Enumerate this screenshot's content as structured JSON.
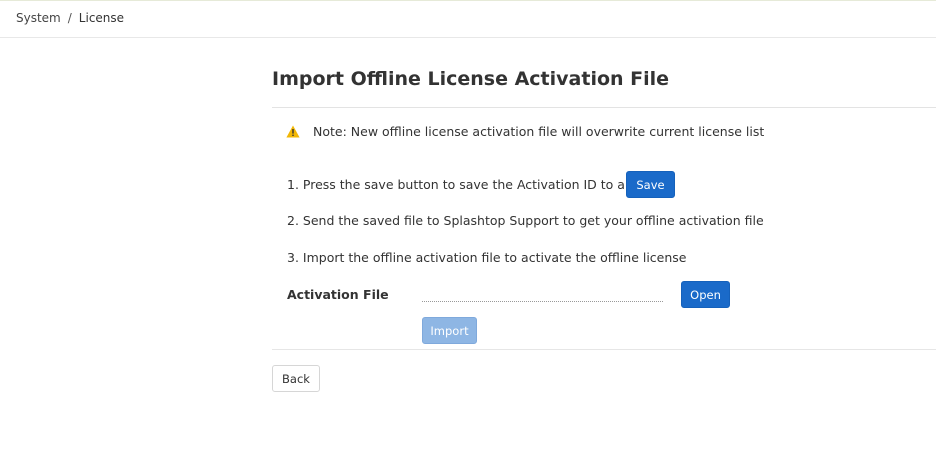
{
  "breadcrumb": {
    "items": [
      "System",
      "License"
    ],
    "separator": "/"
  },
  "page": {
    "title": "Import Offline License Activation File"
  },
  "note": {
    "icon": "warning-icon",
    "text": "Note: New offline license activation file will overwrite current license list"
  },
  "steps": [
    "1. Press the save button to save the Activation ID to a file",
    "2. Send the saved file to Splashtop Support to get your offline activation file",
    "3. Import the offline activation file to activate the offline license"
  ],
  "buttons": {
    "save": "Save",
    "open": "Open",
    "import": "Import",
    "back": "Back"
  },
  "activation_file": {
    "label": "Activation File",
    "value": "",
    "placeholder": ""
  },
  "colors": {
    "primary": "#1a6ac9",
    "primary_disabled": "#8eb6e4",
    "warning": "#f2b705"
  }
}
